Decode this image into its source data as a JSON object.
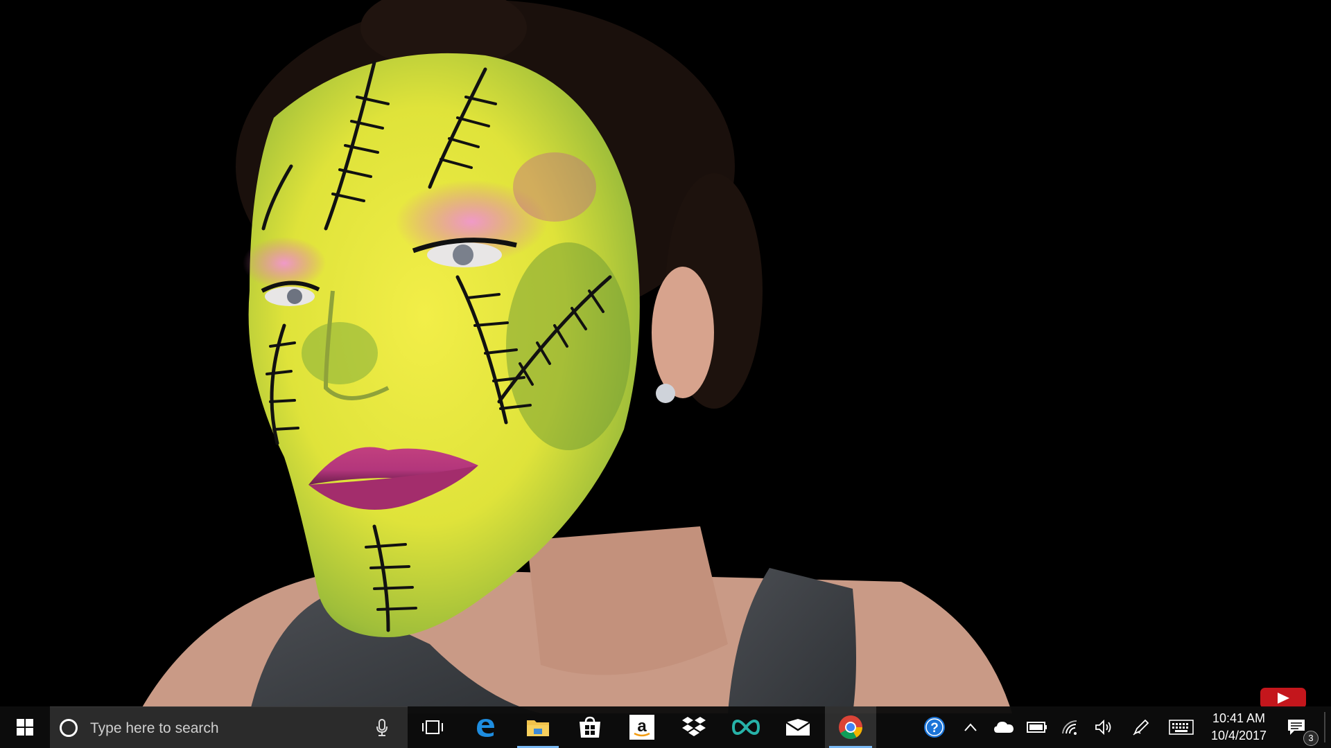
{
  "taskbar": {
    "search_placeholder": "Type here to search",
    "clock_time": "10:41 AM",
    "clock_date": "10/4/2017",
    "notification_count": "3",
    "apps": [
      {
        "name": "task-view-icon"
      },
      {
        "name": "edge-icon"
      },
      {
        "name": "file-explorer-icon"
      },
      {
        "name": "store-icon"
      },
      {
        "name": "amazon-icon"
      },
      {
        "name": "dropbox-icon"
      },
      {
        "name": "infinity-app-icon"
      },
      {
        "name": "mail-icon"
      },
      {
        "name": "chrome-icon"
      }
    ],
    "tray": [
      "help-icon",
      "show-hidden-icons-chevron",
      "onedrive-icon",
      "battery-icon",
      "wifi-icon",
      "volume-icon",
      "pen-icon",
      "touch-keyboard-icon",
      "action-center-icon"
    ]
  },
  "colors": {
    "taskbar_bg": "#0c0c0c",
    "search_bg": "#2b2b2b",
    "running_indicator": "#79b8f3",
    "youtube_red": "#c4161c",
    "face_paint_yellow": "#e6ea3c",
    "face_paint_green": "#7aa83a",
    "lip_magenta": "#b3367c",
    "eyeshadow_pink": "#e77fb6"
  }
}
